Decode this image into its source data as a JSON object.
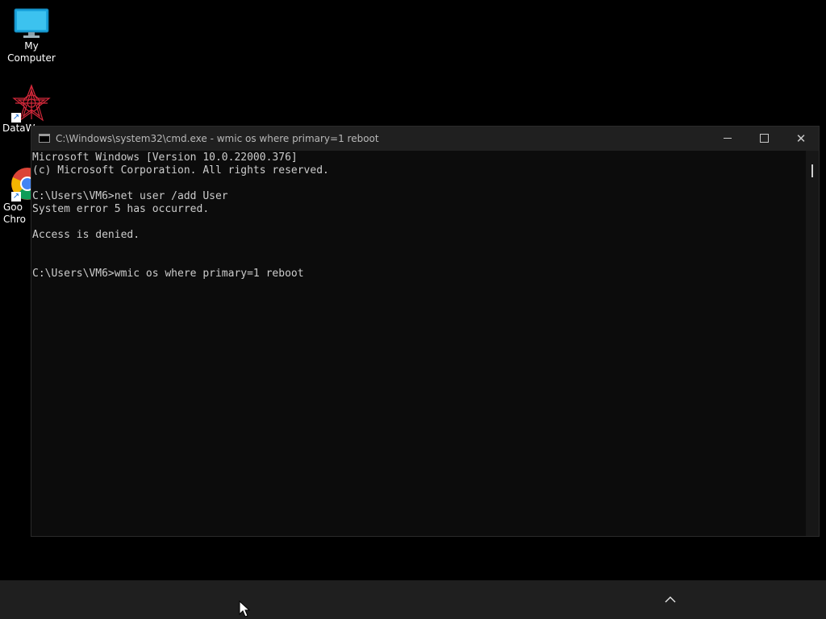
{
  "desktop": {
    "icons": [
      {
        "label": "My Computer",
        "icon": "monitor-icon"
      },
      {
        "label": "DataW",
        "icon": "datawarrior-icon"
      },
      {
        "label": "Goo\nChro",
        "icon": "chrome-icon"
      }
    ]
  },
  "window": {
    "title": "C:\\Windows\\system32\\cmd.exe - wmic  os where primary=1 reboot",
    "minimize_icon": "minimize-icon",
    "maximize_icon": "maximize-icon",
    "close_glyph": "✕"
  },
  "console": {
    "lines": [
      "Microsoft Windows [Version 10.0.22000.376]",
      "(c) Microsoft Corporation. All rights reserved.",
      "",
      "C:\\Users\\VM6>net user /add User",
      "System error 5 has occurred.",
      "",
      "Access is denied.",
      "",
      "",
      "C:\\Users\\VM6>wmic os where primary=1 reboot"
    ]
  },
  "taskbar": {
    "tray_icon": "chevron-up-icon"
  },
  "colors": {
    "console_bg": "#0c0c0c",
    "console_fg": "#cccccc",
    "titlebar_bg": "#202020",
    "taskbar_bg": "#1f1f1f"
  }
}
